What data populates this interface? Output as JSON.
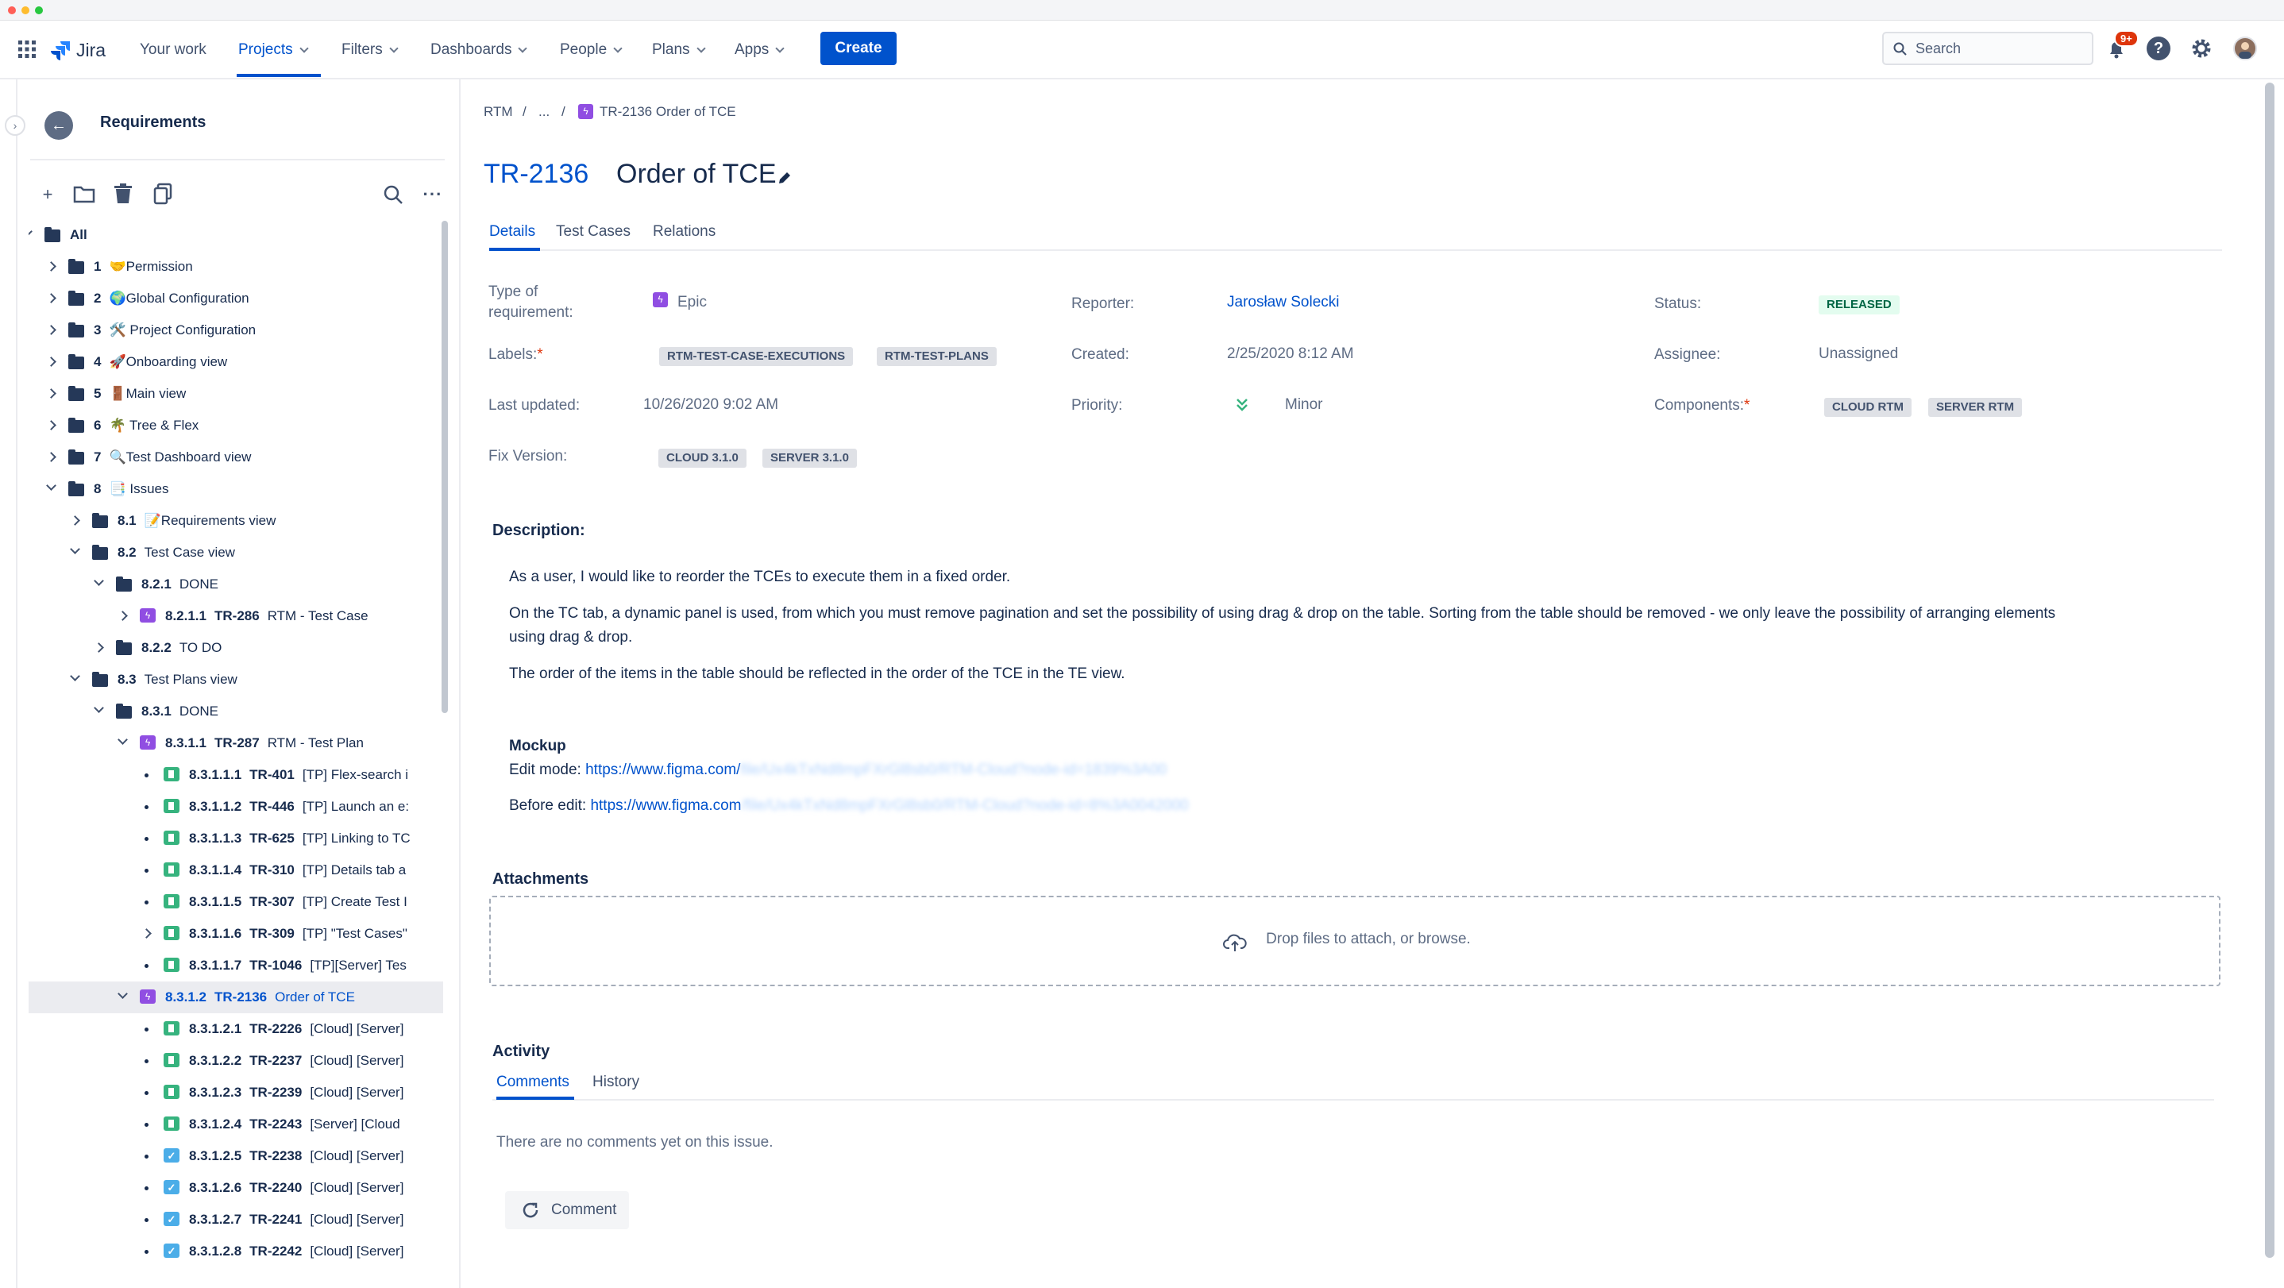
{
  "topnav": {
    "logo_text": "Jira",
    "items": [
      {
        "label": "Your work",
        "dropdown": false
      },
      {
        "label": "Projects",
        "dropdown": true,
        "active": true
      },
      {
        "label": "Filters",
        "dropdown": true
      },
      {
        "label": "Dashboards",
        "dropdown": true
      },
      {
        "label": "People",
        "dropdown": true
      },
      {
        "label": "Plans",
        "dropdown": true
      },
      {
        "label": "Apps",
        "dropdown": true
      }
    ],
    "create_label": "Create",
    "search_placeholder": "Search",
    "notification_badge": "9+",
    "help_icon": "help-icon",
    "settings_icon": "gear-icon",
    "accent_color": "#0052cc"
  },
  "sidebar": {
    "title": "Requirements",
    "toolbar_icons": [
      "plus-icon",
      "folder-icon",
      "trash-icon",
      "copy-icon",
      "search-icon",
      "more-icon"
    ],
    "tree": [
      {
        "depth": 0,
        "exp": "open",
        "type": "folder",
        "num": "",
        "key": "",
        "text": "All"
      },
      {
        "depth": 1,
        "exp": "closed",
        "type": "folder",
        "num": "1",
        "key": "",
        "text": "🤝Permission"
      },
      {
        "depth": 1,
        "exp": "closed",
        "type": "folder",
        "num": "2",
        "key": "",
        "text": "🌍Global Configuration"
      },
      {
        "depth": 1,
        "exp": "closed",
        "type": "folder",
        "num": "3",
        "key": "",
        "text": "🛠️ Project Configuration"
      },
      {
        "depth": 1,
        "exp": "closed",
        "type": "folder",
        "num": "4",
        "key": "",
        "text": "🚀Onboarding view"
      },
      {
        "depth": 1,
        "exp": "closed",
        "type": "folder",
        "num": "5",
        "key": "",
        "text": "🚪Main view"
      },
      {
        "depth": 1,
        "exp": "closed",
        "type": "folder",
        "num": "6",
        "key": "",
        "text": "🌴 Tree & Flex"
      },
      {
        "depth": 1,
        "exp": "closed",
        "type": "folder",
        "num": "7",
        "key": "",
        "text": "🔍Test Dashboard view"
      },
      {
        "depth": 1,
        "exp": "open",
        "type": "folder",
        "num": "8",
        "key": "",
        "text": "📑 Issues"
      },
      {
        "depth": 2,
        "exp": "closed",
        "type": "folder",
        "num": "8.1",
        "key": "",
        "text": "📝Requirements view"
      },
      {
        "depth": 2,
        "exp": "open",
        "type": "folder",
        "num": "8.2",
        "key": "",
        "text": "Test Case view"
      },
      {
        "depth": 3,
        "exp": "open",
        "type": "folder",
        "num": "8.2.1",
        "key": "",
        "text": "DONE"
      },
      {
        "depth": 4,
        "exp": "closed",
        "type": "epic",
        "num": "8.2.1.1",
        "key": "TR-286",
        "text": "RTM - Test Case"
      },
      {
        "depth": 3,
        "exp": "closed",
        "type": "folder",
        "num": "8.2.2",
        "key": "",
        "text": "TO DO"
      },
      {
        "depth": 2,
        "exp": "open",
        "type": "folder",
        "num": "8.3",
        "key": "",
        "text": "Test Plans view"
      },
      {
        "depth": 3,
        "exp": "open",
        "type": "folder",
        "num": "8.3.1",
        "key": "",
        "text": "DONE"
      },
      {
        "depth": 4,
        "exp": "open",
        "type": "epic",
        "num": "8.3.1.1",
        "key": "TR-287",
        "text": "RTM - Test Plan"
      },
      {
        "depth": 5,
        "exp": "bullet",
        "type": "story",
        "num": "8.3.1.1.1",
        "key": "TR-401",
        "text": "[TP] Flex-search i"
      },
      {
        "depth": 5,
        "exp": "bullet",
        "type": "story",
        "num": "8.3.1.1.2",
        "key": "TR-446",
        "text": "[TP] Launch an e:"
      },
      {
        "depth": 5,
        "exp": "bullet",
        "type": "story",
        "num": "8.3.1.1.3",
        "key": "TR-625",
        "text": "[TP] Linking to TC"
      },
      {
        "depth": 5,
        "exp": "bullet",
        "type": "story",
        "num": "8.3.1.1.4",
        "key": "TR-310",
        "text": "[TP] Details tab a"
      },
      {
        "depth": 5,
        "exp": "bullet",
        "type": "story",
        "num": "8.3.1.1.5",
        "key": "TR-307",
        "text": "[TP] Create Test I"
      },
      {
        "depth": 5,
        "exp": "closed",
        "type": "story",
        "num": "8.3.1.1.6",
        "key": "TR-309",
        "text": "[TP] \"Test Cases\""
      },
      {
        "depth": 5,
        "exp": "bullet",
        "type": "story",
        "num": "8.3.1.1.7",
        "key": "TR-1046",
        "text": "[TP][Server] Tes"
      },
      {
        "depth": 4,
        "exp": "open",
        "type": "epic",
        "num": "8.3.1.2",
        "key": "TR-2136",
        "text": "Order of TCE",
        "selected": true
      },
      {
        "depth": 5,
        "exp": "bullet",
        "type": "story",
        "num": "8.3.1.2.1",
        "key": "TR-2226",
        "text": "[Cloud] [Server]"
      },
      {
        "depth": 5,
        "exp": "bullet",
        "type": "story",
        "num": "8.3.1.2.2",
        "key": "TR-2237",
        "text": "[Cloud] [Server]"
      },
      {
        "depth": 5,
        "exp": "bullet",
        "type": "story",
        "num": "8.3.1.2.3",
        "key": "TR-2239",
        "text": "[Cloud] [Server]"
      },
      {
        "depth": 5,
        "exp": "bullet",
        "type": "story",
        "num": "8.3.1.2.4",
        "key": "TR-2243",
        "text": "[Server] [Cloud"
      },
      {
        "depth": 5,
        "exp": "bullet",
        "type": "task",
        "num": "8.3.1.2.5",
        "key": "TR-2238",
        "text": "[Cloud] [Server]"
      },
      {
        "depth": 5,
        "exp": "bullet",
        "type": "task",
        "num": "8.3.1.2.6",
        "key": "TR-2240",
        "text": "[Cloud] [Server]"
      },
      {
        "depth": 5,
        "exp": "bullet",
        "type": "task",
        "num": "8.3.1.2.7",
        "key": "TR-2241",
        "text": "[Cloud] [Server]"
      },
      {
        "depth": 5,
        "exp": "bullet",
        "type": "task",
        "num": "8.3.1.2.8",
        "key": "TR-2242",
        "text": "[Cloud] [Server]"
      }
    ]
  },
  "breadcrumb": {
    "root": "RTM",
    "sep1": "/",
    "ellipsis": "...",
    "sep2": "/",
    "current": "TR-2136 Order of TCE"
  },
  "issue": {
    "key": "TR-2136",
    "title": "Order of TCE",
    "tabs": [
      "Details",
      "Test Cases",
      "Relations"
    ],
    "fields": {
      "type_label": "Type of requirement:",
      "type_value": "Epic",
      "reporter_label": "Reporter:",
      "reporter_value": "Jarosław Solecki",
      "status_label": "Status:",
      "status_value": "RELEASED",
      "labels_label": "Labels:",
      "labels": [
        "RTM-TEST-CASE-EXECUTIONS",
        "RTM-TEST-PLANS"
      ],
      "created_label": "Created:",
      "created_value": "2/25/2020 8:12 AM",
      "assignee_label": "Assignee:",
      "assignee_value": "Unassigned",
      "updated_label": "Last updated:",
      "updated_value": "10/26/2020 9:02 AM",
      "priority_label": "Priority:",
      "priority_value": "Minor",
      "components_label": "Components:",
      "components": [
        "CLOUD RTM",
        "SERVER RTM"
      ],
      "fixversion_label": "Fix Version:",
      "fixversions": [
        "CLOUD 3.1.0",
        "SERVER 3.1.0"
      ],
      "required_mark": "*"
    },
    "description": {
      "heading": "Description:",
      "p1": "As a user, I would like to reorder the TCEs to execute them in a fixed order.",
      "p2a": "On the TC tab, a dynamic panel is used, from which you must remove pagination and set the possibility of using drag & drop on the table. Sorting from the table should be removed - we only leave the possibility of arranging elements",
      "p2b": "using drag & drop.",
      "p3": "The order of the items in the table should be reflected in the order of the TCE in the TE view.",
      "mockup_heading": "Mockup",
      "edit_label": "Edit mode:",
      "edit_link": "https://www.figma.com/",
      "edit_blur": "file/Ux4kTxNd8mpFXrGl8sb0/RTM-Cloud?node-id=1839%3A00",
      "before_label": "Before edit:",
      "before_link": "https://www.figma.com",
      "before_blur": "/file/Ux4kTxNd8mpFXrGl8sb0/RTM-Cloud?node-id=8%3A0042000"
    },
    "attachments": {
      "heading": "Attachments",
      "drop_text": "Drop files to attach, or browse."
    },
    "activity": {
      "heading": "Activity",
      "tabs": [
        "Comments",
        "History"
      ],
      "empty": "There are no comments yet on this issue.",
      "comment_button": "Comment"
    }
  }
}
